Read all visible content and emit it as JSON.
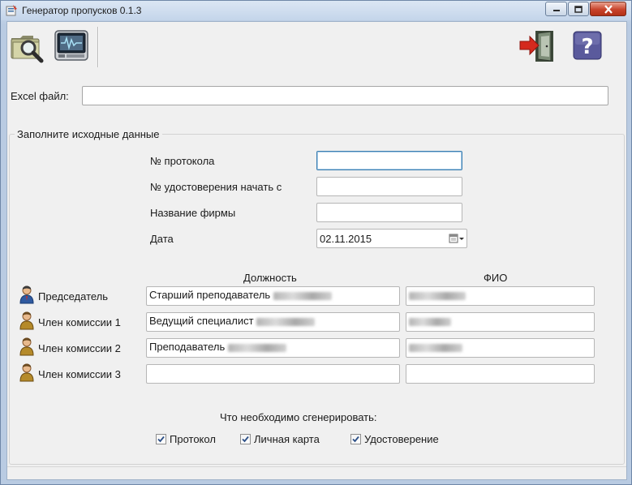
{
  "window": {
    "title": "Генератор пропусков 0.1.3",
    "controls": {
      "minimize": "minimize",
      "maximize": "maximize",
      "close": "close"
    }
  },
  "toolbar": {
    "items": [
      {
        "name": "open",
        "icon": "folder-search-icon"
      },
      {
        "name": "generate",
        "icon": "printer-icon"
      },
      {
        "name": "exit",
        "icon": "exit-door-icon"
      },
      {
        "name": "help",
        "icon": "help-icon",
        "glyph": "?"
      }
    ]
  },
  "excel": {
    "label": "Excel файл:",
    "value": ""
  },
  "group": {
    "title": "Заполните исходные данные",
    "fields": {
      "protocol_label": "№ протокола",
      "protocol_value": "",
      "certificate_label": "№ удостоверения начать с",
      "certificate_value": "",
      "company_label": "Название фирмы",
      "company_value": "",
      "date_label": "Дата",
      "date_value": "02.11.2015"
    },
    "columns": {
      "position": "Должность",
      "name": "ФИО"
    },
    "members": [
      {
        "role": "Председатель",
        "position": "Старший преподаватель",
        "name": ""
      },
      {
        "role": "Член комиссии 1",
        "position": "Ведущий специалист",
        "name": ""
      },
      {
        "role": "Член комиссии 2",
        "position": "Преподаватель",
        "name": ""
      },
      {
        "role": "Член комиссии 3",
        "position": "",
        "name": ""
      }
    ],
    "generate": {
      "title": "Что необходимо сгенерировать:",
      "options": [
        {
          "label": "Протокол",
          "checked": true
        },
        {
          "label": "Личная карта",
          "checked": true
        },
        {
          "label": "Удостоверение",
          "checked": true
        }
      ]
    }
  },
  "colors": {
    "accent": "#3c7fb1",
    "exit_arrow": "#d42a1e",
    "help_bg": "#5a5a9c"
  }
}
